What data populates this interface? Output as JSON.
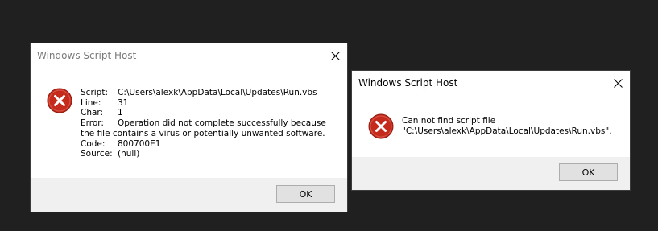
{
  "dialog_main": {
    "title": "Windows Script Host",
    "icon": "error-icon",
    "fields": {
      "script_label": "Script:",
      "script_value": "C:\\Users\\alexk\\AppData\\Local\\Updates\\Run.vbs",
      "line_label": "Line:",
      "line_value": "31",
      "char_label": "Char:",
      "char_value": "1",
      "error_label": "Error:",
      "error_value_line1": "Operation did not complete successfully because",
      "error_value_line2": "the file contains a virus or potentially unwanted software.",
      "code_label": "Code:",
      "code_value": "800700E1",
      "source_label": "Source:",
      "source_value": "(null)"
    },
    "ok_label": "OK"
  },
  "dialog_secondary": {
    "title": "Windows Script Host",
    "icon": "error-icon",
    "message_line1": "Can not find script file",
    "message_line2": "\"C:\\Users\\alexk\\AppData\\Local\\Updates\\Run.vbs\".",
    "ok_label": "OK"
  },
  "colors": {
    "desktop_background": "#202020",
    "error_red": "#c42b1c",
    "footer_gray": "#f0f0f0"
  }
}
